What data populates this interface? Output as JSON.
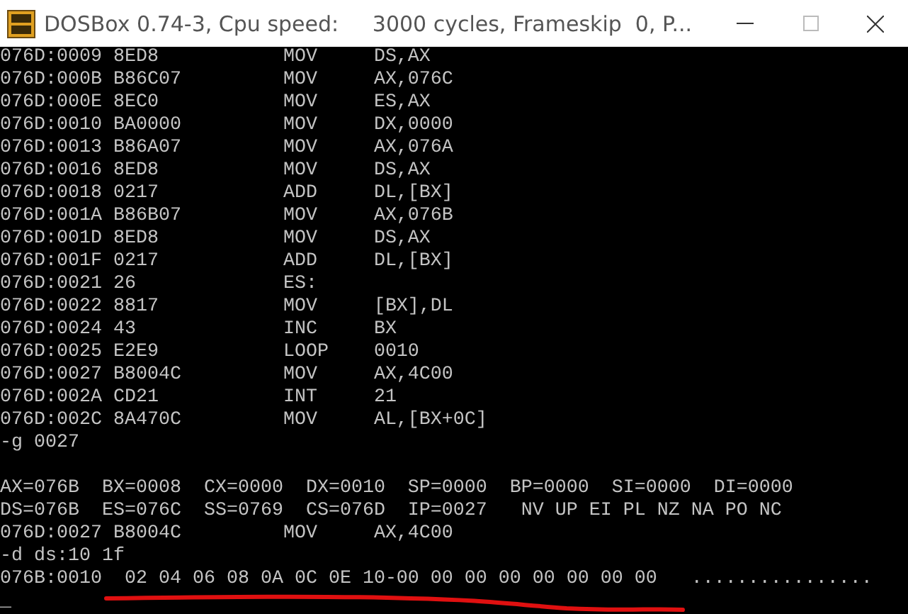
{
  "window": {
    "title": "DOSBox 0.74-3, Cpu speed:     3000 cycles, Frameskip  0, P..."
  },
  "terminal": {
    "lines": [
      {
        "kind": "text",
        "text": "076D:0009 8ED8           MOV     DS,AX"
      },
      {
        "kind": "text",
        "text": "076D:000B B86C07         MOV     AX,076C"
      },
      {
        "kind": "text",
        "text": "076D:000E 8EC0           MOV     ES,AX"
      },
      {
        "kind": "text",
        "text": "076D:0010 BA0000         MOV     DX,0000"
      },
      {
        "kind": "text",
        "text": "076D:0013 B86A07         MOV     AX,076A"
      },
      {
        "kind": "text",
        "text": "076D:0016 8ED8           MOV     DS,AX"
      },
      {
        "kind": "text",
        "text": "076D:0018 0217           ADD     DL,[BX]"
      },
      {
        "kind": "text",
        "text": "076D:001A B86B07         MOV     AX,076B"
      },
      {
        "kind": "text",
        "text": "076D:001D 8ED8           MOV     DS,AX"
      },
      {
        "kind": "text",
        "text": "076D:001F 0217           ADD     DL,[BX]"
      },
      {
        "kind": "text",
        "text": "076D:0021 26             ES:"
      },
      {
        "kind": "text",
        "text": "076D:0022 8817           MOV     [BX],DL"
      },
      {
        "kind": "text",
        "text": "076D:0024 43             INC     BX"
      },
      {
        "kind": "text",
        "text": "076D:0025 E2E9           LOOP    0010"
      },
      {
        "kind": "text",
        "text": "076D:0027 B8004C         MOV     AX,4C00"
      },
      {
        "kind": "text",
        "text": "076D:002A CD21           INT     21"
      },
      {
        "kind": "text",
        "text": "076D:002C 8A470C         MOV     AL,[BX+0C]"
      },
      {
        "kind": "text",
        "text": "-g 0027"
      },
      {
        "kind": "blank"
      },
      {
        "kind": "text",
        "text": "AX=076B  BX=0008  CX=0000  DX=0010  SP=0000  BP=0000  SI=0000  DI=0000"
      },
      {
        "kind": "text",
        "text": "DS=076B  ES=076C  SS=0769  CS=076D  IP=0027   NV UP EI PL NZ NA PO NC"
      },
      {
        "kind": "text",
        "text": "076D:0027 B8004C         MOV     AX,4C00"
      },
      {
        "kind": "text",
        "text": "-d ds:10 1f"
      },
      {
        "kind": "text",
        "text": "076B:0010  02 04 06 08 0A 0C 0E 10-00 00 00 00 00 00 00 00   ................"
      },
      {
        "kind": "text",
        "text": "_"
      }
    ]
  }
}
